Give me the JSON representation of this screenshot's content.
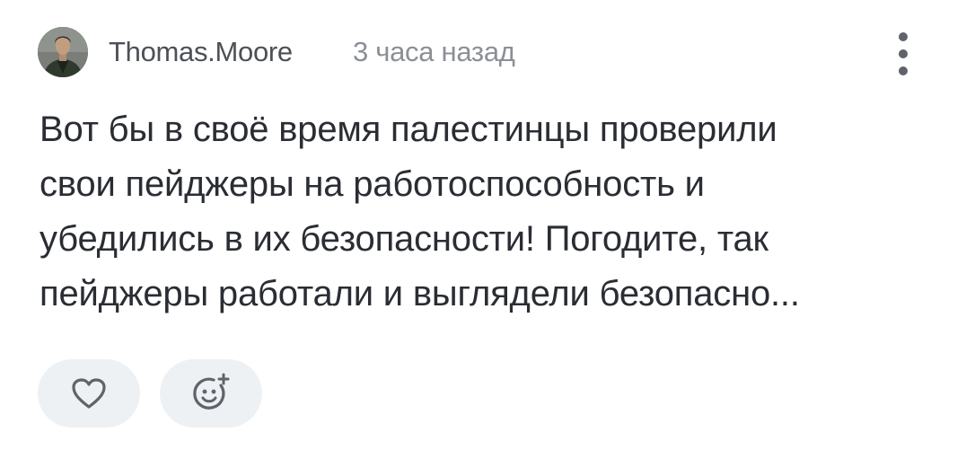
{
  "comment": {
    "author": "Thomas.Moore",
    "time": "3 часа назад",
    "avatar_icon": "user-avatar",
    "more_icon": "more-vertical-icon",
    "text_lines": [
      "Вот бы в своё время палестинцы проверили",
      "свои пейджеры на работоспособность и",
      "убедились в их безопасности! Погодите, так",
      "пейджеры работали и выглядели безопасно..."
    ]
  },
  "actions": {
    "like_icon": "heart-icon",
    "react_icon": "add-emoji-icon"
  },
  "colors": {
    "author": "#4d5057",
    "time": "#8b8f96",
    "text": "#2a2d33",
    "pill_bg": "#eef1f4",
    "icon": "#5f636a"
  }
}
